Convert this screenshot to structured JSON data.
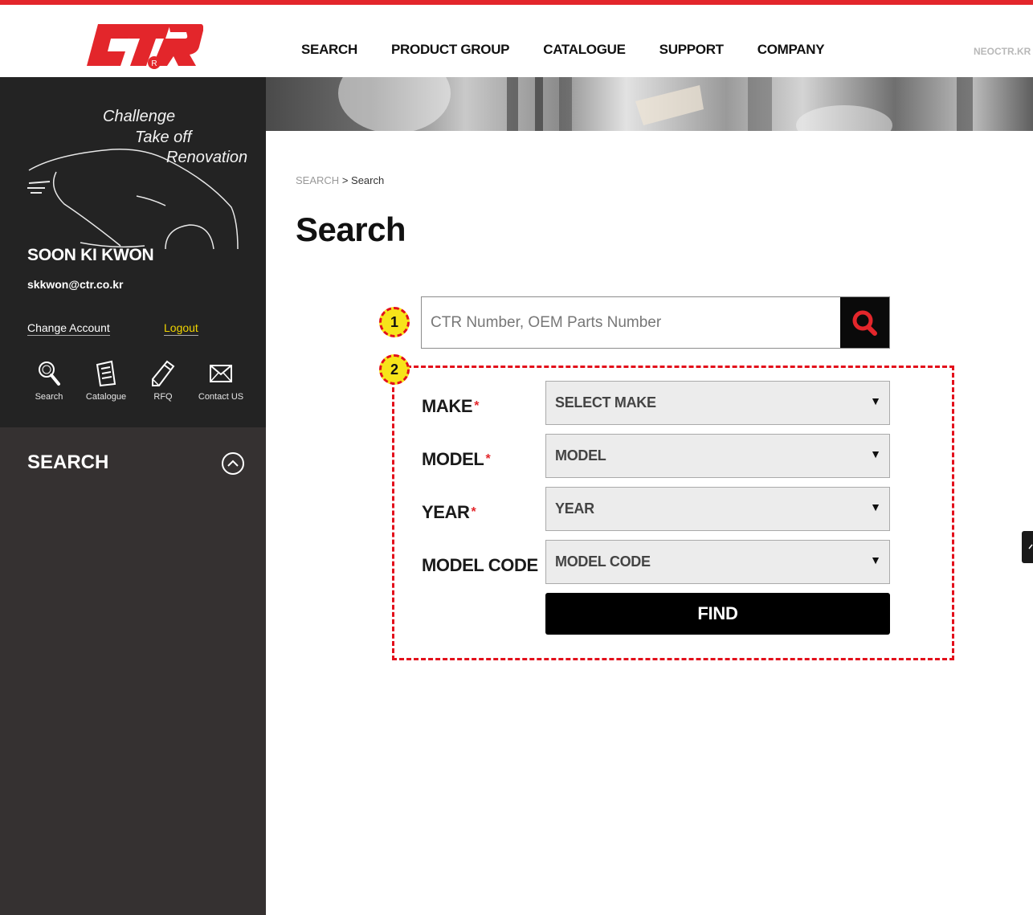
{
  "colors": {
    "brand_red": "#e3262b",
    "sidebar_dark": "#232323",
    "sidebar_body": "#353131",
    "logout_yellow": "#f0d400",
    "badge_yellow": "#f7e41a"
  },
  "logo": {
    "text": "CTR",
    "icon": "ctr-logo"
  },
  "nav": {
    "items": [
      {
        "label": "SEARCH"
      },
      {
        "label": "PRODUCT GROUP"
      },
      {
        "label": "CATALOGUE"
      },
      {
        "label": "SUPPORT"
      },
      {
        "label": "COMPANY"
      }
    ],
    "site_link": "NEOCTR.KR"
  },
  "sidebar": {
    "slogan": {
      "line1": "Challenge",
      "line2": "Take off",
      "line3": "Renovation"
    },
    "user": {
      "name": "SOON KI KWON",
      "email": "skkwon@ctr.co.kr"
    },
    "change_account": "Change Account",
    "logout": "Logout",
    "quick_links": [
      {
        "label": "Search",
        "icon": "search-icon"
      },
      {
        "label": "Catalogue",
        "icon": "document-icon"
      },
      {
        "label": "RFQ",
        "icon": "pencil-icon"
      },
      {
        "label": "Contact US",
        "icon": "mail-icon"
      }
    ],
    "menu_title": "SEARCH"
  },
  "breadcrumb": {
    "root": "SEARCH",
    "separator": ">",
    "current": "Search"
  },
  "page_title": "Search",
  "search": {
    "placeholder": "CTR Number, OEM Parts Number",
    "value": ""
  },
  "annotations": {
    "badge1": "1",
    "badge2": "2"
  },
  "form": {
    "make": {
      "label": "MAKE",
      "required": "*",
      "selected": "SELECT MAKE"
    },
    "model": {
      "label": "MODEL",
      "required": "*",
      "selected": "MODEL"
    },
    "year": {
      "label": "YEAR",
      "required": "*",
      "selected": "YEAR"
    },
    "model_code": {
      "label": "MODEL CODE",
      "selected": "MODEL CODE"
    },
    "arrow": "▼",
    "find_label": "FIND"
  }
}
